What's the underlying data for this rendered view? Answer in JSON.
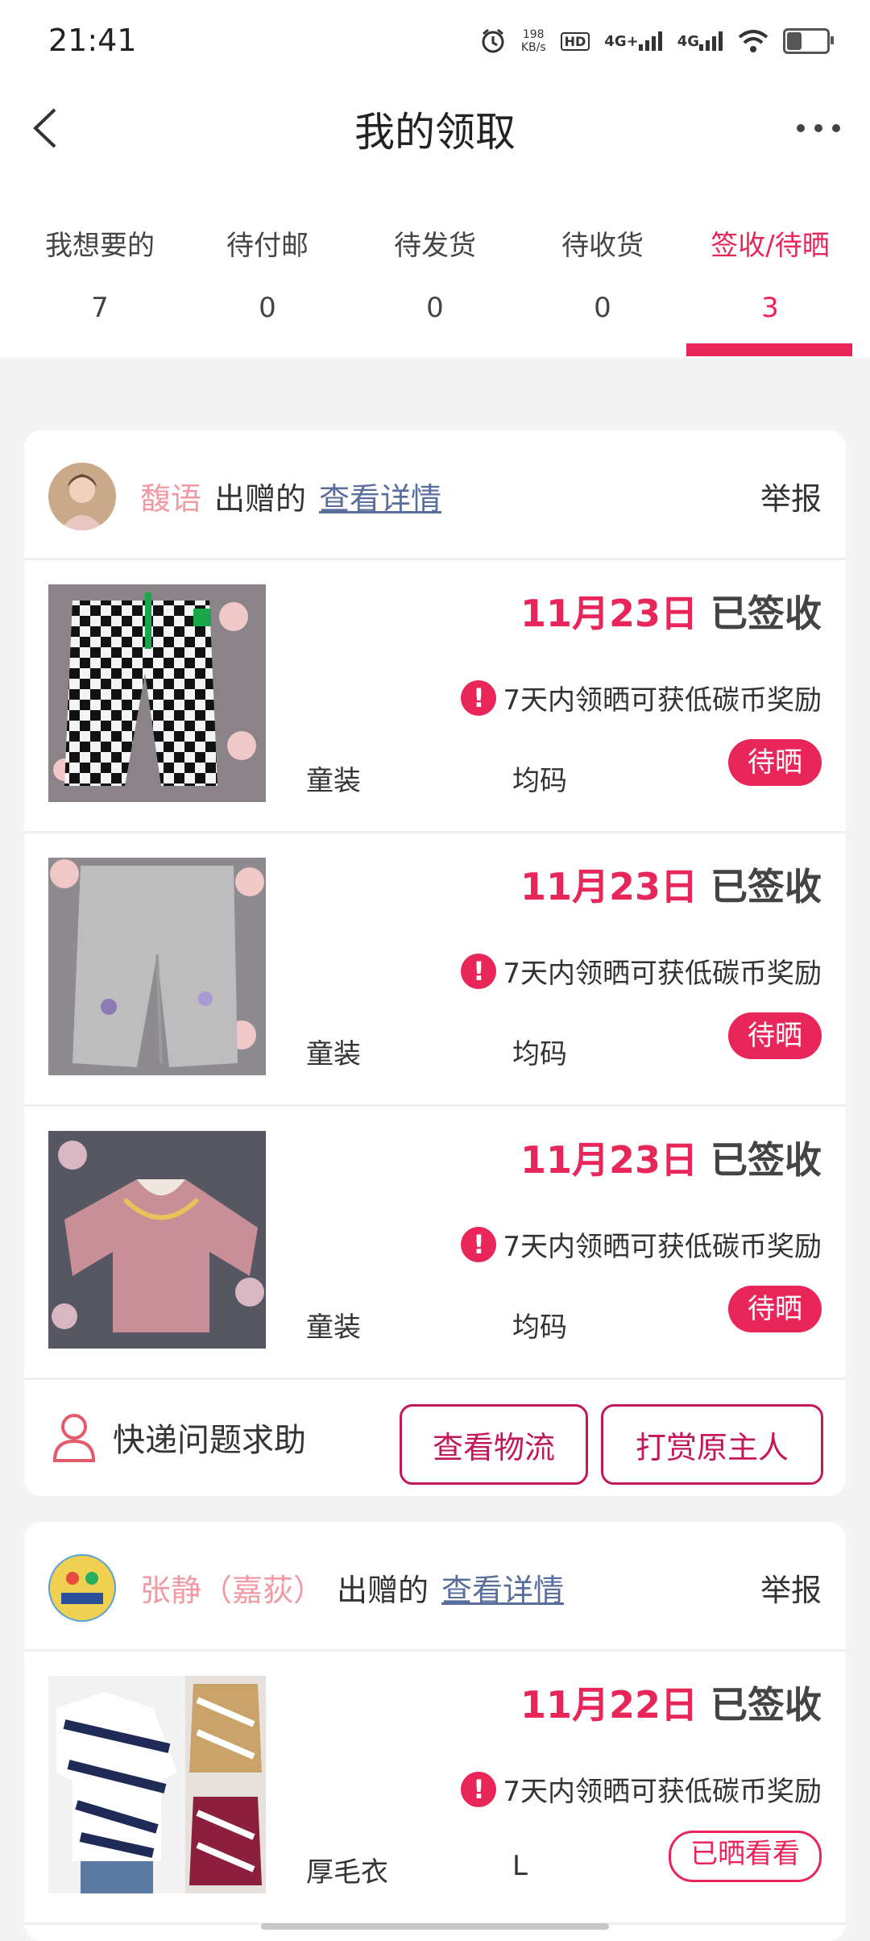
{
  "status": {
    "time": "21:41",
    "speed_value": "198",
    "speed_unit": "KB/s",
    "hd": "HD",
    "net1": "4G+",
    "net2": "4G"
  },
  "header": {
    "title": "我的领取"
  },
  "tabs": [
    {
      "label": "我想要的",
      "count": "7"
    },
    {
      "label": "待付邮",
      "count": "0"
    },
    {
      "label": "待发货",
      "count": "0"
    },
    {
      "label": "待收货",
      "count": "0"
    },
    {
      "label": "签收/待晒",
      "count": "3",
      "active": true
    }
  ],
  "accent_color": "#e8265a",
  "orders": [
    {
      "giver": "馥语",
      "giver_suffix": "出赠的",
      "detail_link": "查看详情",
      "report": "举报",
      "items": [
        {
          "date": "11月23日",
          "status": "已签收",
          "tip": "7天内领晒可获低碳币奖励",
          "category": "童装",
          "size": "均码",
          "action": "待晒",
          "image": "checkered-pants"
        },
        {
          "date": "11月23日",
          "status": "已签收",
          "tip": "7天内领晒可获低碳币奖励",
          "category": "童装",
          "size": "均码",
          "action": "待晒",
          "image": "grey-pants"
        },
        {
          "date": "11月23日",
          "status": "已签收",
          "tip": "7天内领晒可获低碳币奖励",
          "category": "童装",
          "size": "均码",
          "action": "待晒",
          "image": "pink-sweater"
        }
      ],
      "footer": {
        "help": "快递问题求助",
        "logistics": "查看物流",
        "tip_owner": "打赏原主人"
      }
    },
    {
      "giver": "张静（嘉荻）",
      "giver_suffix": "出赠的",
      "detail_link": "查看详情",
      "report": "举报",
      "items": [
        {
          "date": "11月22日",
          "status": "已签收",
          "tip": "7天内领晒可获低碳币奖励",
          "category": "厚毛衣",
          "size": "L",
          "action": "已晒看看",
          "image": "zebra-sweaters"
        }
      ]
    }
  ]
}
